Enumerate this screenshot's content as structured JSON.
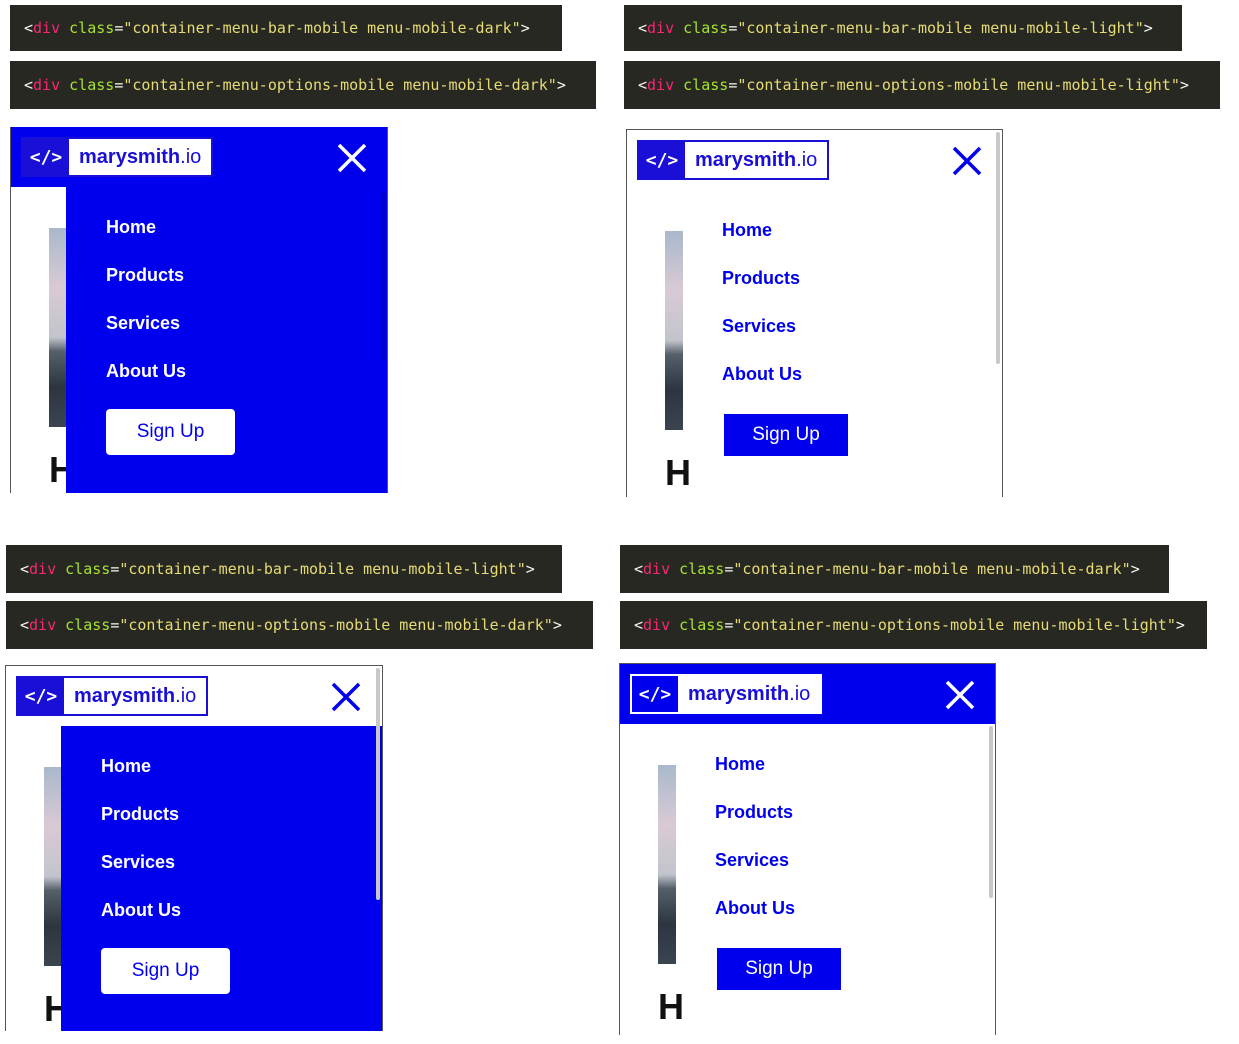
{
  "panels": [
    {
      "code_lines": [
        {
          "tag": "div",
          "attr": "class",
          "value": "container-menu-bar-mobile menu-mobile-dark"
        },
        {
          "tag": "div",
          "attr": "class",
          "value": "container-menu-options-mobile menu-mobile-dark"
        }
      ],
      "logo": {
        "mark": "</>",
        "name": "marysmith",
        "tld": ".io"
      },
      "menu_items": [
        "Home",
        "Products",
        "Services",
        "About Us"
      ],
      "signup_label": "Sign Up",
      "hero_letter": "H"
    },
    {
      "code_lines": [
        {
          "tag": "div",
          "attr": "class",
          "value": "container-menu-bar-mobile menu-mobile-light"
        },
        {
          "tag": "div",
          "attr": "class",
          "value": "container-menu-options-mobile menu-mobile-light"
        }
      ],
      "logo": {
        "mark": "</>",
        "name": "marysmith",
        "tld": ".io"
      },
      "menu_items": [
        "Home",
        "Products",
        "Services",
        "About Us"
      ],
      "signup_label": "Sign Up",
      "hero_letter": "H"
    },
    {
      "code_lines": [
        {
          "tag": "div",
          "attr": "class",
          "value": "container-menu-bar-mobile menu-mobile-light"
        },
        {
          "tag": "div",
          "attr": "class",
          "value": "container-menu-options-mobile menu-mobile-dark"
        }
      ],
      "logo": {
        "mark": "</>",
        "name": "marysmith",
        "tld": ".io"
      },
      "menu_items": [
        "Home",
        "Products",
        "Services",
        "About Us"
      ],
      "signup_label": "Sign Up",
      "hero_letter": "H"
    },
    {
      "code_lines": [
        {
          "tag": "div",
          "attr": "class",
          "value": "container-menu-bar-mobile menu-mobile-dark"
        },
        {
          "tag": "div",
          "attr": "class",
          "value": "container-menu-options-mobile menu-mobile-light"
        }
      ],
      "logo": {
        "mark": "</>",
        "name": "marysmith",
        "tld": ".io"
      },
      "menu_items": [
        "Home",
        "Products",
        "Services",
        "About Us"
      ],
      "signup_label": "Sign Up",
      "hero_letter": "H"
    }
  ],
  "colors": {
    "brand_blue": "#0000ee",
    "code_bg": "#272822",
    "code_tag": "#f92672",
    "code_attr": "#a6e22e",
    "code_string": "#e6db74"
  },
  "icons": {
    "close": "close-icon",
    "logo_mark": "code-brackets-icon"
  }
}
